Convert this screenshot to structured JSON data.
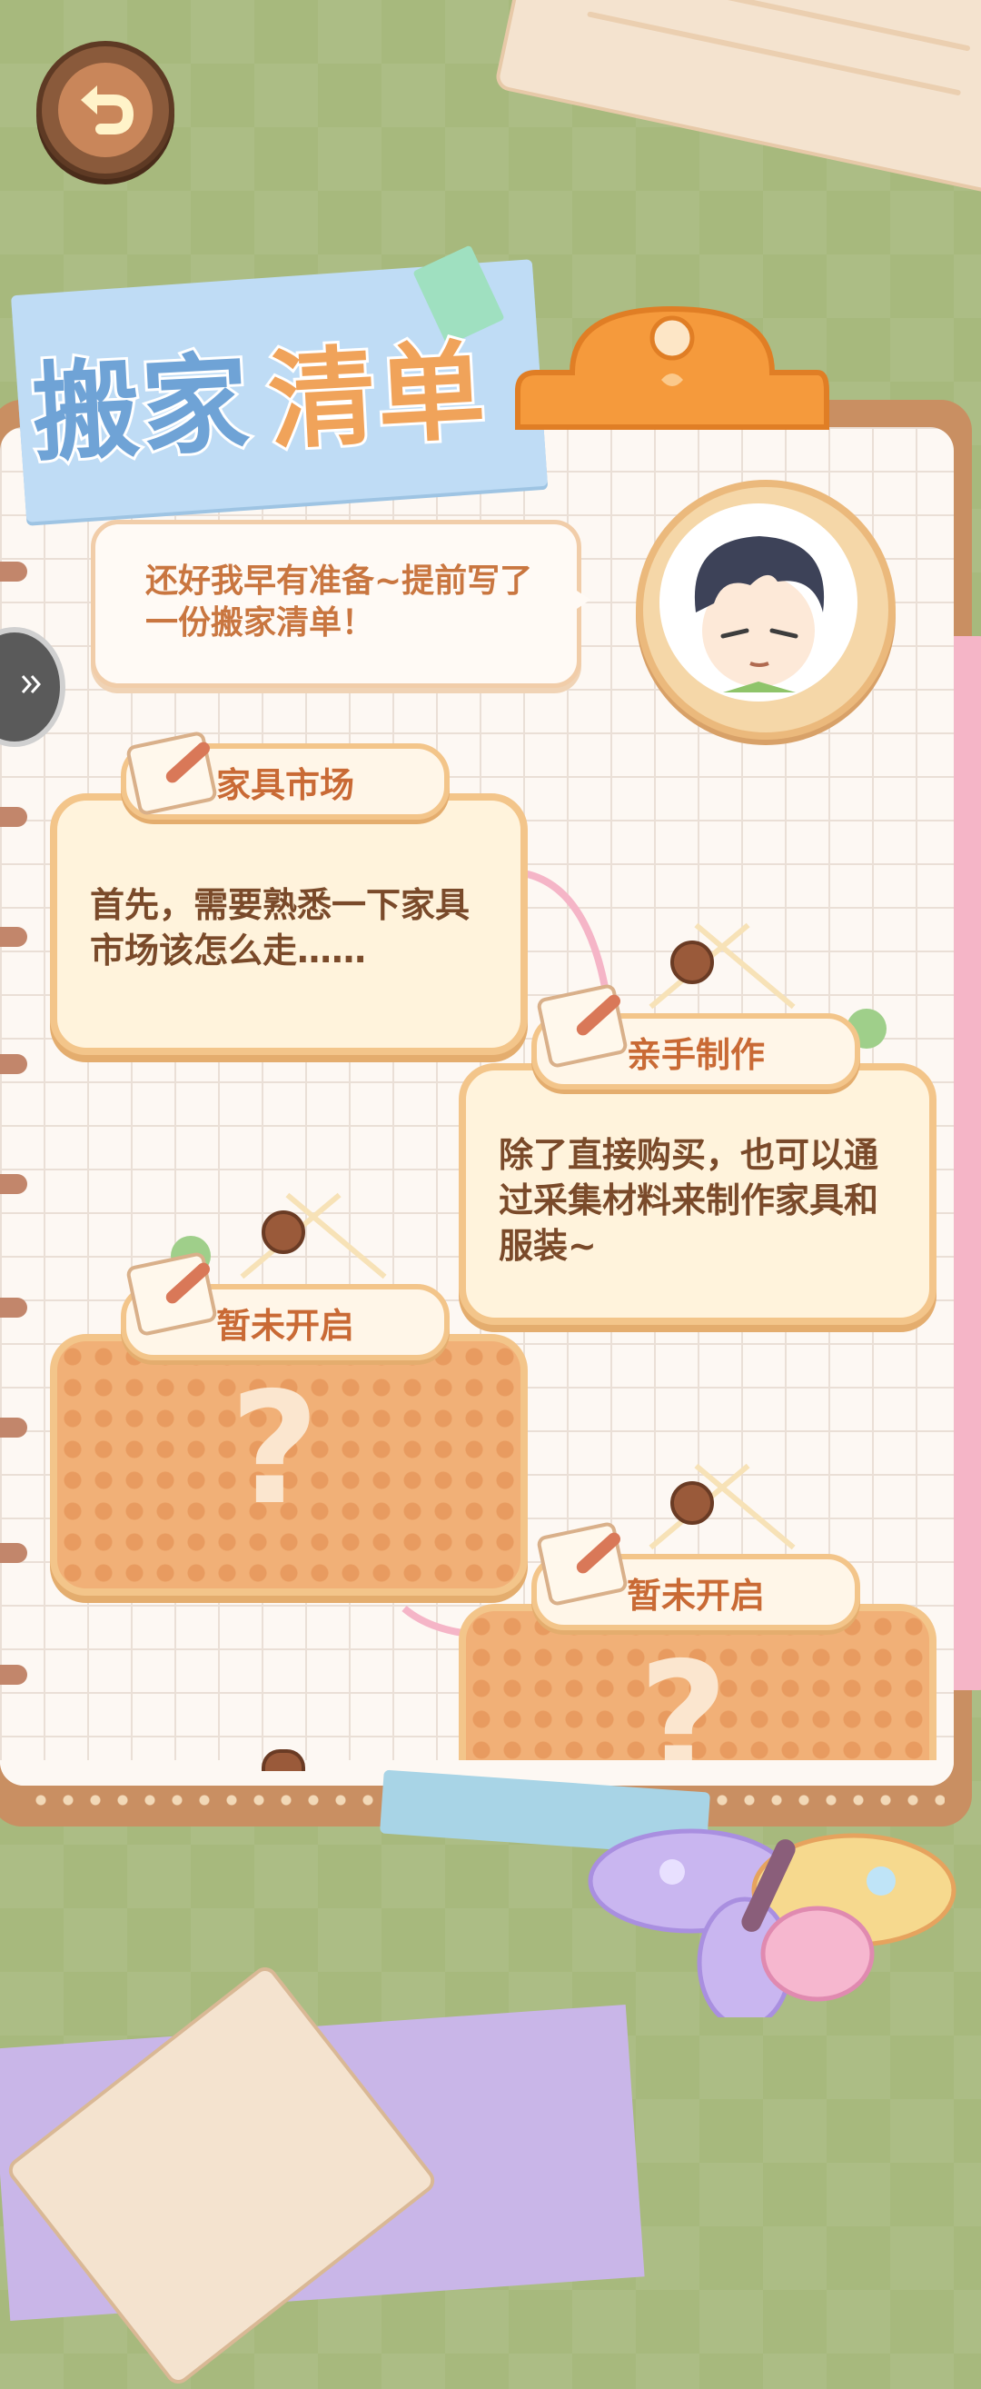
{
  "header": {
    "title_part1": "搬家",
    "title_part2": "清单"
  },
  "icons": {
    "back": "back-arrow-icon",
    "expand": "double-chevron-right-icon"
  },
  "speech": {
    "text": "还好我早有准备~提前写了一份搬家清单！"
  },
  "cards": [
    {
      "tag": "家具市场",
      "text": "首先，需要熟悉一下家具市场该怎么走……",
      "locked": false
    },
    {
      "tag": "亲手制作",
      "text": "除了直接购买，也可以通过采集材料来制作家具和服装~",
      "locked": false
    },
    {
      "tag": "暂未开启",
      "symbol": "?",
      "locked": true
    },
    {
      "tag": "暂未开启",
      "symbol": "?",
      "locked": true
    }
  ],
  "colors": {
    "background": "#a7b97d",
    "card_border": "#f3c58a",
    "tag_text": "#c96a35",
    "body_text": "#7a4a2a",
    "locked_card": "#f1b077"
  }
}
